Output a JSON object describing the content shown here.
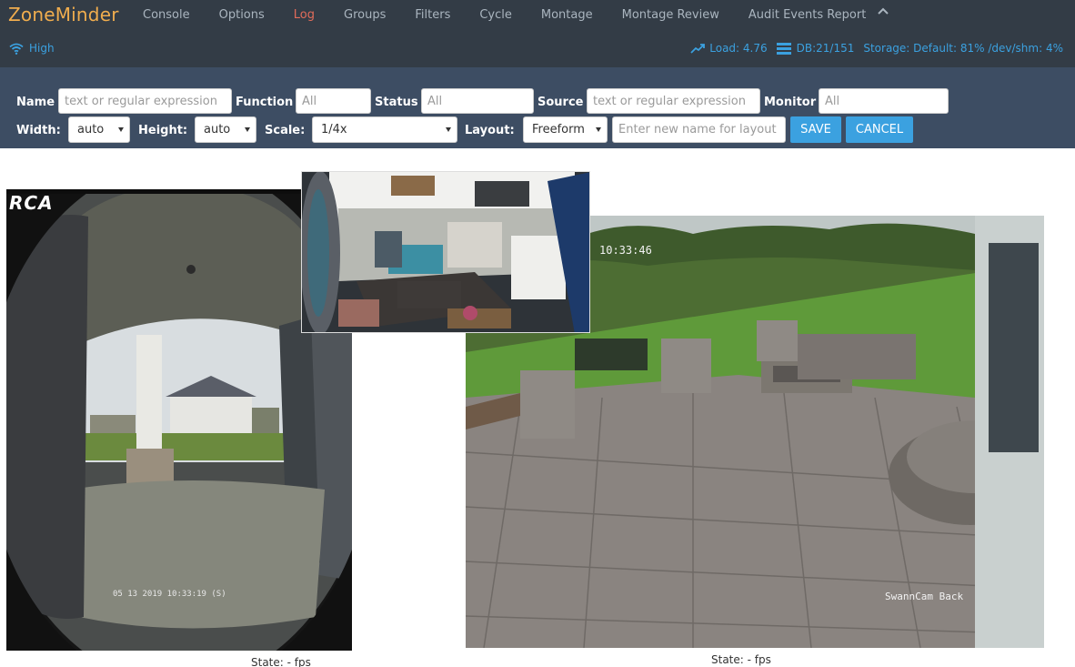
{
  "brand": "ZoneMinder",
  "nav": [
    "Console",
    "Options",
    "Log",
    "Groups",
    "Filters",
    "Cycle",
    "Montage",
    "Montage Review",
    "Audit Events Report"
  ],
  "status": {
    "bandwidth": "High",
    "load": "Load: 4.76",
    "db": "DB:21/151",
    "storage": "Storage: Default: 81% /dev/shm: 4%"
  },
  "filters": {
    "name_label": "Name",
    "name_placeholder": "text or regular expression",
    "function_label": "Function",
    "function_placeholder": "All",
    "status_label": "Status",
    "status_placeholder": "All",
    "source_label": "Source",
    "source_placeholder": "text or regular expression",
    "monitor_label": "Monitor",
    "monitor_placeholder": "All"
  },
  "options": {
    "width_label": "Width:",
    "width_value": "auto",
    "height_label": "Height:",
    "height_value": "auto",
    "scale_label": "Scale:",
    "scale_value": "1/4x",
    "layout_label": "Layout:",
    "layout_value": "Freeform",
    "layout_name_placeholder": "Enter new name for layout",
    "save": "SAVE",
    "cancel": "CANCEL"
  },
  "monitors": {
    "front_logo": "RCA",
    "front_timestamp": "05 13 2019 10:33:19 (S)",
    "back_time": "10:33:46",
    "back_caption": "SwannCam Back",
    "front_state": "State:  -  fps",
    "back_state": "State:  -  fps"
  },
  "colors": {
    "nav_bg": "#333c46",
    "filter_bg": "#3d4d63",
    "brand": "#f0ad4e",
    "active_link": "#e26c5a",
    "accent": "#3ba1e0"
  }
}
